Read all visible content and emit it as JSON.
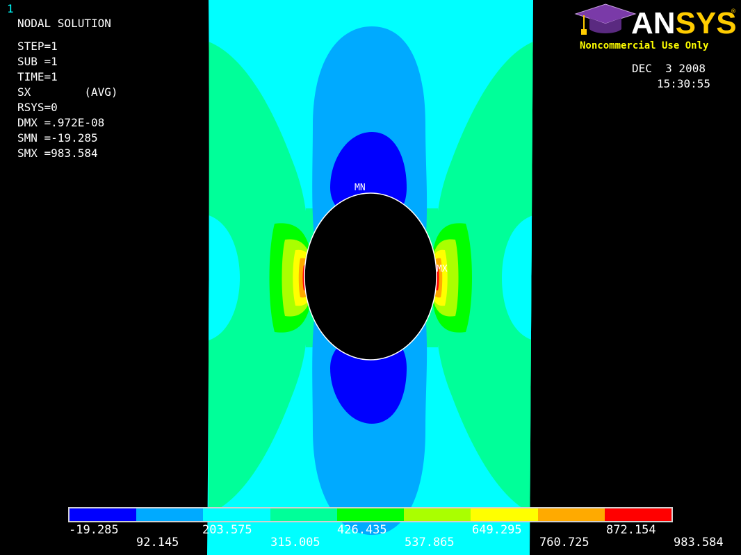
{
  "window": {
    "number": "1"
  },
  "header": {
    "title": "NODAL SOLUTION",
    "lines": [
      "STEP=1",
      "SUB =1",
      "TIME=1",
      "SX        (AVG)",
      "RSYS=0",
      "DMX =.972E-08",
      "SMN =-19.285",
      "SMX =983.584"
    ]
  },
  "logo": {
    "brand": "ANSYS",
    "registered": "®",
    "notice": "Noncommercial Use Only"
  },
  "timestamp": {
    "date": "DEC  3 2008",
    "time": "15:30:55"
  },
  "markers": {
    "min": "MN",
    "max": "MX"
  },
  "legend": {
    "colors": [
      "#0000ff",
      "#00aaff",
      "#00ffff",
      "#00ff99",
      "#00ff00",
      "#aaff00",
      "#ffff00",
      "#ffaa00",
      "#ff0000"
    ],
    "top_labels": [
      "-19.285",
      "203.575",
      "426.435",
      "649.295",
      "872.154"
    ],
    "bottom_labels": [
      "92.145",
      "315.005",
      "537.865",
      "760.725",
      "983.584"
    ]
  }
}
